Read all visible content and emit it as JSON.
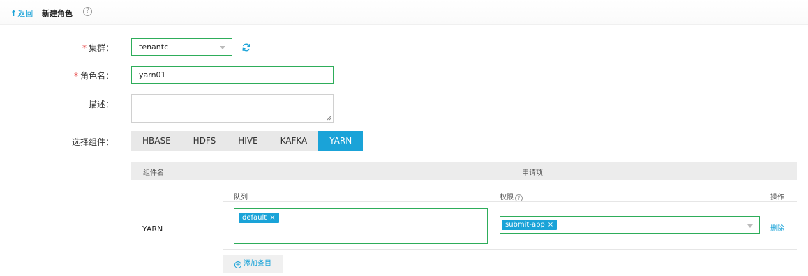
{
  "header": {
    "back_arrow": "↑",
    "back_label": "返回",
    "title": "新建角色",
    "help_glyph": "?"
  },
  "form": {
    "cluster": {
      "required_mark": "*",
      "label": "集群：",
      "value": "tenantc"
    },
    "role_name": {
      "required_mark": "*",
      "label": "角色名：",
      "value": "yarn01"
    },
    "description": {
      "label": "描述：",
      "value": ""
    },
    "component": {
      "label": "选择组件：",
      "tabs": [
        "HBASE",
        "HDFS",
        "HIVE",
        "KAFKA",
        "YARN"
      ],
      "active_index": 4
    }
  },
  "table": {
    "header_component": "组件名",
    "header_apply": "申请项",
    "sub_queue": "队列",
    "sub_permission": "权限",
    "sub_operation": "操作",
    "rows": [
      {
        "component": "YARN",
        "queue_tags": [
          {
            "label": "default",
            "remove": "×"
          }
        ],
        "permission_tags": [
          {
            "label": "submit-app",
            "remove": "×"
          }
        ],
        "delete_label": "删除"
      }
    ],
    "add_label": "添加条目",
    "add_glyph": "+"
  },
  "colors": {
    "accent": "#1aa3d8",
    "valid_border": "#2ead5a",
    "required": "#e64545"
  }
}
